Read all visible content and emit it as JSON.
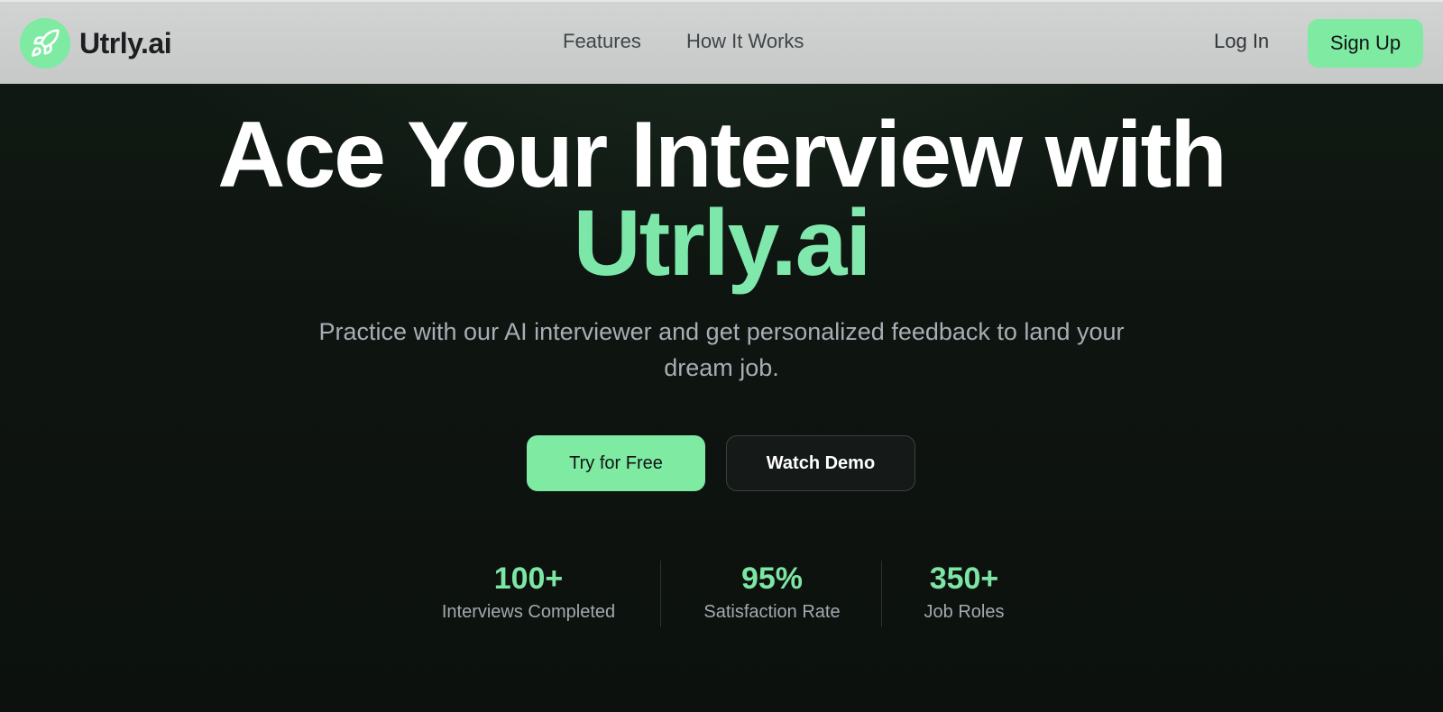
{
  "header": {
    "brand": "Utrly.ai",
    "logo_icon": "rocket-icon",
    "nav": [
      {
        "label": "Features"
      },
      {
        "label": "How It Works"
      }
    ],
    "login_label": "Log In",
    "signup_label": "Sign Up"
  },
  "hero": {
    "title_line1": "Ace Your Interview with",
    "title_line2": "Utrly.ai",
    "subtitle": "Practice with our AI interviewer and get personalized feedback to land your dream job.",
    "primary_cta": "Try for Free",
    "secondary_cta": "Watch Demo"
  },
  "stats": [
    {
      "value": "100+",
      "label": "Interviews Completed"
    },
    {
      "value": "95%",
      "label": "Satisfaction Rate"
    },
    {
      "value": "350+",
      "label": "Job Roles"
    }
  ],
  "colors": {
    "accent": "#7eeaa2",
    "background": "#0d120f",
    "navbar": "#cbcecc"
  }
}
